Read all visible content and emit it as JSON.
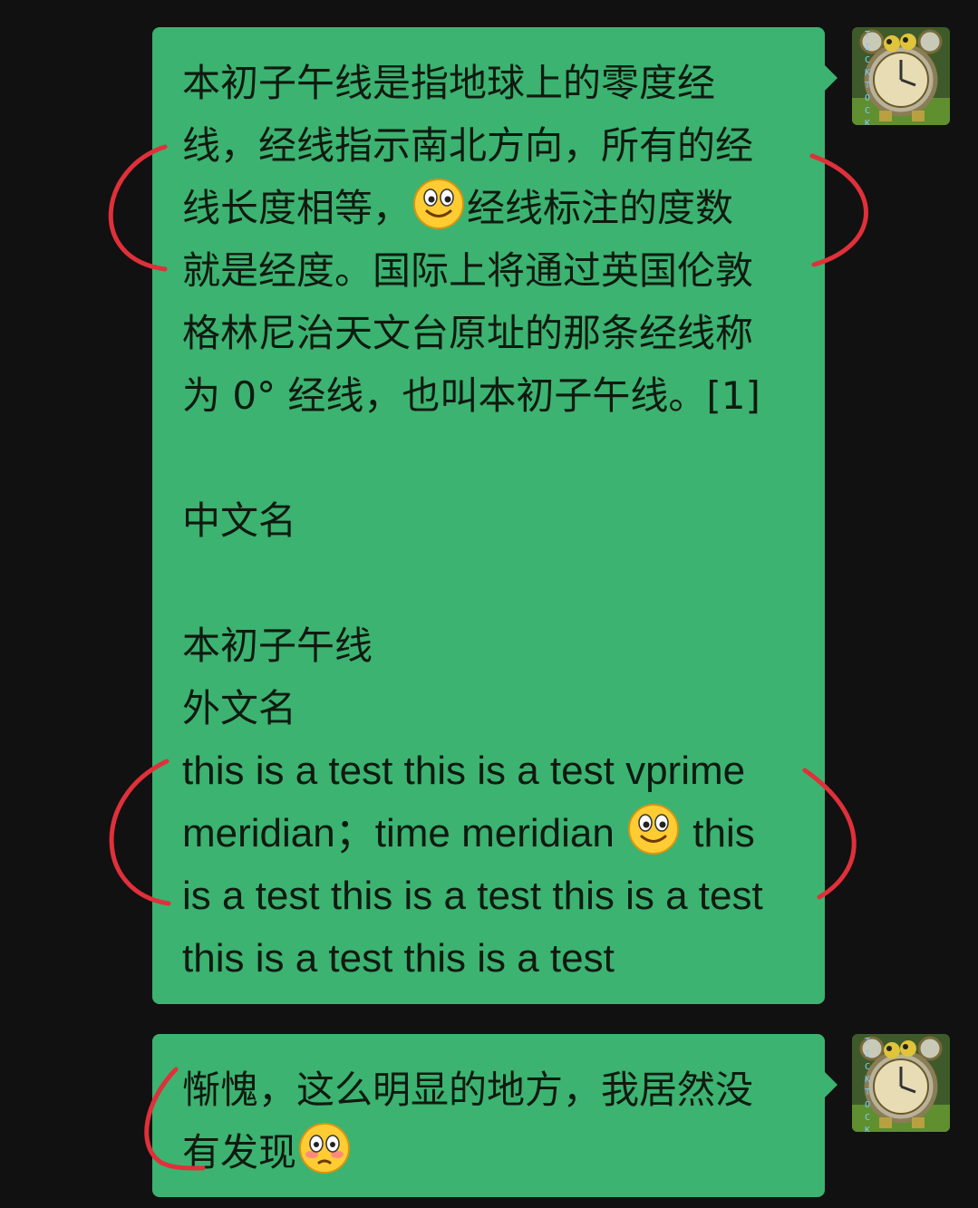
{
  "messages": [
    {
      "sender": "self",
      "lines": [
        "本初子午线是指地球上的零度经",
        "线，经线指示南北方向，所有的经",
        "线长度相等，",
        "经线标注的度数",
        "就是经度。国际上将通过英国伦敦",
        "格林尼治天文台原址的那条经线称",
        "为 0° 经线，也叫本初子午线。[1]",
        "中文名",
        "本初子午线",
        "外文名",
        "this is a test this is a test vprime",
        "meridian；time meridian",
        "this",
        "is a test this is a test this is a test",
        "this is a test this is a test"
      ],
      "emojis": [
        "smile-emoji",
        "smile-emoji"
      ]
    },
    {
      "sender": "self",
      "lines": [
        "惭愧，这么明显的地方，我居然没",
        "有发现"
      ],
      "emojis": [
        "flushed-emoji"
      ]
    }
  ],
  "avatar": {
    "label": "TICKTOCK",
    "icon": "alarm-clock-avatar"
  },
  "annotations": {
    "color": "#e0303a",
    "marks": [
      "bracket-left",
      "bracket-right",
      "bracket-left",
      "bracket-right",
      "hook"
    ]
  },
  "colors": {
    "background": "#111111",
    "bubble": "#3cb371",
    "text": "#0f1a10"
  }
}
